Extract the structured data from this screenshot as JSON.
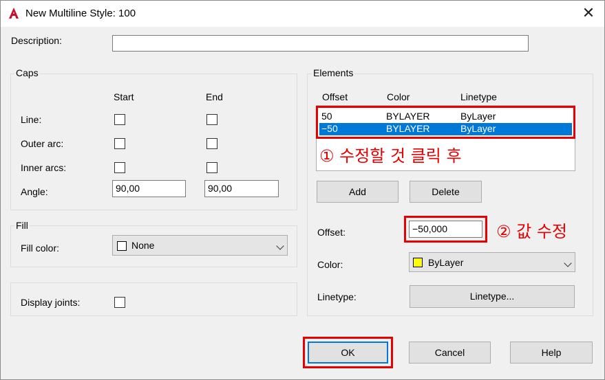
{
  "window": {
    "title": "New Multiline Style: 100",
    "close_glyph": "✕",
    "app_icon": "autocad-a-icon",
    "accent": "#c8102e"
  },
  "description": {
    "label": "Description:",
    "value": ""
  },
  "caps": {
    "legend": "Caps",
    "start_header": "Start",
    "end_header": "End",
    "line_label": "Line:",
    "outer_arc_label": "Outer arc:",
    "inner_arcs_label": "Inner arcs:",
    "angle_label": "Angle:",
    "angle_start": "90,00",
    "angle_end": "90,00"
  },
  "fill": {
    "legend": "Fill",
    "color_label": "Fill color:",
    "color_value": "None"
  },
  "display_joints_label": "Display joints:",
  "elements": {
    "legend": "Elements",
    "headers": {
      "offset": "Offset",
      "color": "Color",
      "linetype": "Linetype"
    },
    "rows": [
      {
        "offset": "50",
        "color": "BYLAYER",
        "linetype": "ByLayer",
        "selected": false
      },
      {
        "offset": "−50",
        "color": "BYLAYER",
        "linetype": "ByLayer",
        "selected": true
      }
    ],
    "add_label": "Add",
    "delete_label": "Delete",
    "offset_label": "Offset:",
    "offset_value": "−50,000",
    "color_label": "Color:",
    "color_value": "ByLayer",
    "color_swatch": "#ffff00",
    "linetype_label": "Linetype:",
    "linetype_button": "Linetype..."
  },
  "annotations": {
    "step1": "① 수정할 것 클릭 후",
    "step2": "② 값 수정",
    "color": "#e60000"
  },
  "buttons": {
    "ok": "OK",
    "cancel": "Cancel",
    "help": "Help"
  },
  "colors": {
    "selection": "#0078d7",
    "dialog_bg": "#f0f0f0",
    "ok_border": "#0078d7"
  }
}
